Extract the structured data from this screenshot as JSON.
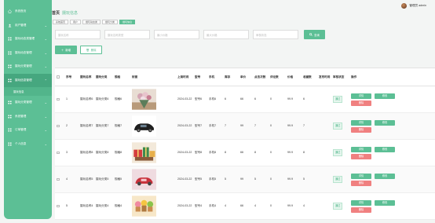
{
  "sidebar": {
    "items": [
      {
        "label": "系统首页",
        "icon": "home-icon",
        "chev": ""
      },
      {
        "label": "用户管理",
        "icon": "user-icon",
        "chev": "⌄"
      },
      {
        "label": "摄玩动态类管理",
        "icon": "grid-icon",
        "chev": "⌄"
      },
      {
        "label": "摄玩动态管理",
        "icon": "grid-icon",
        "chev": "⌄"
      },
      {
        "label": "摄玩分类管理",
        "icon": "grid-icon",
        "chev": "⌄"
      },
      {
        "label": "摄玩信息管理",
        "icon": "grid-icon",
        "chev": "⌃"
      },
      {
        "label": "摄玩分类管理",
        "icon": "grid-icon",
        "chev": "⌄"
      },
      {
        "label": "系统管理",
        "icon": "grid-icon",
        "chev": "⌄"
      },
      {
        "label": "订单管理",
        "icon": "grid-icon",
        "chev": "⌄"
      },
      {
        "label": "个人信息",
        "icon": "grid-icon",
        "chev": "⌄"
      }
    ],
    "subitem": "摄玩信息"
  },
  "header": {
    "title": "首页",
    "subtitle": "摄玩信息",
    "user_label": "管理员 admin"
  },
  "tags": [
    "系统首页",
    "用户",
    "摄玩动态类",
    "摄玩分类",
    "摄玩信息"
  ],
  "filters": {
    "f1": "摄玩名称",
    "f2": "摄玩名称类型",
    "f3": "最小价格",
    "f4": "最大价格",
    "f5": "审核状态",
    "search": "查询"
  },
  "actions": {
    "add": "新增",
    "delete": "删除"
  },
  "table": {
    "headers": [
      "",
      "序号",
      "摄玩名称",
      "摄玩分类",
      "规格",
      "封面",
      "上架时间",
      "型号",
      "手机",
      "库存",
      "单价",
      "点击次数",
      "评论数",
      "价格",
      "收藏数",
      "发布时间",
      "审核状态",
      "操作"
    ],
    "rows": [
      {
        "idx": "1",
        "name": "摄玩名称6",
        "cat": "摄玩分类6",
        "spec": "规格6",
        "date": "2024-03-22",
        "model": "型号6",
        "phone": "手机6",
        "stock": "6",
        "price": "66",
        "clicks": "6",
        "comments": "0",
        "cost": "99.9",
        "fav": "6",
        "pub": "",
        "status": "通过",
        "img": "bouquet"
      },
      {
        "idx": "2",
        "name": "摄玩名称7",
        "cat": "摄玩分类7",
        "spec": "规格7",
        "date": "2024-03-22",
        "model": "型号7",
        "phone": "手机7",
        "stock": "7",
        "price": "99",
        "clicks": "7",
        "comments": "0",
        "cost": "99.9",
        "fav": "7",
        "pub": "",
        "status": "通过",
        "img": "car"
      },
      {
        "idx": "3",
        "name": "摄玩名称8",
        "cat": "摄玩分类8",
        "spec": "规格8",
        "date": "2024-03-22",
        "model": "型号8",
        "phone": "手机8",
        "stock": "8",
        "price": "66",
        "clicks": "8",
        "comments": "0",
        "cost": "99.9",
        "fav": "8",
        "pub": "",
        "status": "通过",
        "img": "gifts"
      },
      {
        "idx": "4",
        "name": "摄玩名称5",
        "cat": "摄玩分类5",
        "spec": "规格5",
        "date": "2024-03-22",
        "model": "型号5",
        "phone": "手机5",
        "stock": "5",
        "price": "99",
        "clicks": "5",
        "comments": "0",
        "cost": "99.9",
        "fav": "5",
        "pub": "",
        "status": "通过",
        "img": "toycar"
      },
      {
        "idx": "5",
        "name": "摄玩名称4",
        "cat": "摄玩分类4",
        "spec": "规格4",
        "date": "2024-03-22",
        "model": "型号4",
        "phone": "手机4",
        "stock": "4",
        "price": "66",
        "clicks": "4",
        "comments": "0",
        "cost": "99.9",
        "fav": "4",
        "pub": "",
        "status": "通过",
        "img": "cupcakes"
      }
    ],
    "op_labels": {
      "detail": "详情",
      "edit": "修改",
      "comment": "查看评论",
      "delete": "删除"
    }
  }
}
